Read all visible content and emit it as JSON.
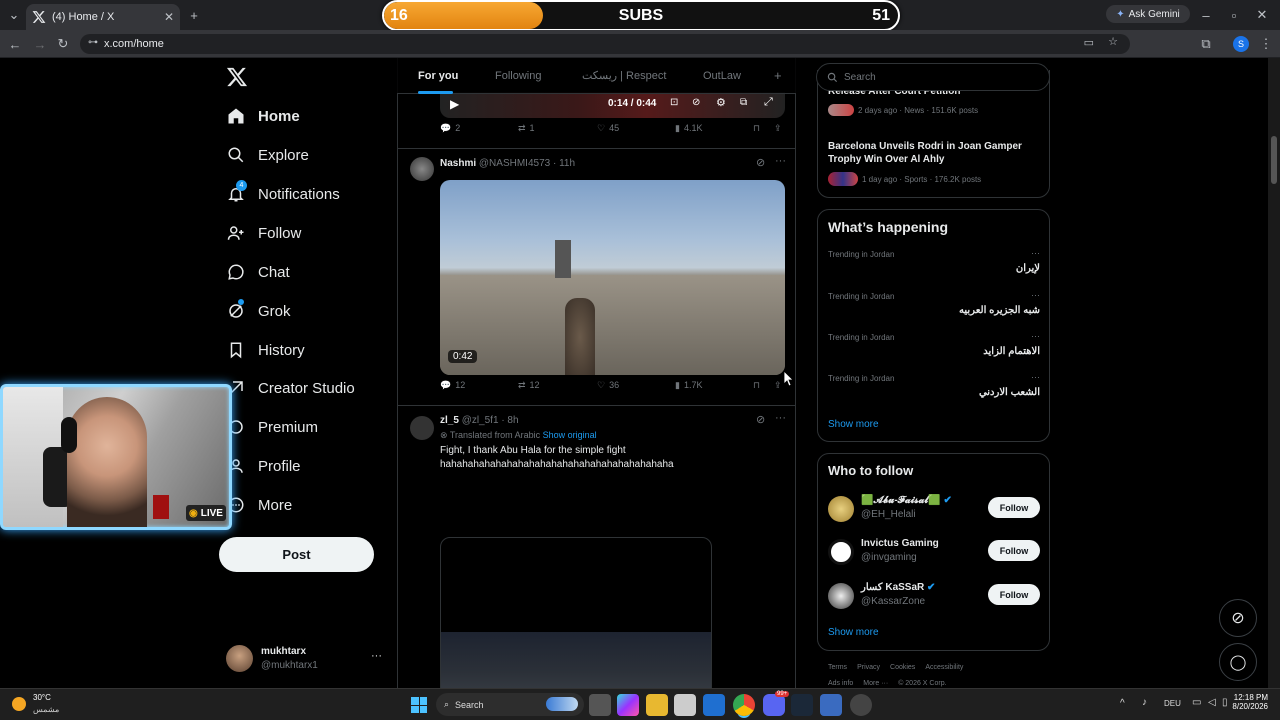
{
  "browser": {
    "tab_title": "(4) Home / X",
    "url": "x.com/home",
    "ask_gemini": "Ask Gemini"
  },
  "overlay": {
    "subs_label": "SUBS",
    "subs_left": "16",
    "subs_right": "51",
    "subs_progress": 0.31,
    "live_label": "LIVE"
  },
  "sidebar": {
    "items": [
      {
        "label": "Home",
        "icon": "home-icon"
      },
      {
        "label": "Explore",
        "icon": "search-icon"
      },
      {
        "label": "Notifications",
        "icon": "bell-icon",
        "badge": "4"
      },
      {
        "label": "Follow",
        "icon": "person-add-icon"
      },
      {
        "label": "Chat",
        "icon": "chat-icon"
      },
      {
        "label": "Grok",
        "icon": "grok-icon"
      },
      {
        "label": "History",
        "icon": "bookmark-icon"
      },
      {
        "label": "Creator Studio",
        "icon": "studio-icon"
      },
      {
        "label": "Premium",
        "icon": "premium-icon"
      },
      {
        "label": "Profile",
        "icon": "profile-icon"
      },
      {
        "label": "More",
        "icon": "more-icon"
      }
    ],
    "post_label": "Post",
    "account": {
      "name": "mukhtarx",
      "handle": "@mukhtarx1",
      "more": "···"
    }
  },
  "feed": {
    "tabs": [
      "For you",
      "Following",
      "ريسكت | Respect",
      "OutLaw"
    ],
    "add_tab": "+",
    "video_time": "0:14 / 0:44",
    "post0": {
      "replies": "2",
      "reposts": "1",
      "likes": "45",
      "views": "4.1K"
    },
    "post1": {
      "name": "Nashmi",
      "handle": "@NASHMI4573",
      "time": "· 11h",
      "duration": "0:42",
      "replies": "12",
      "reposts": "12",
      "likes": "36",
      "views": "1.7K"
    },
    "post2": {
      "name": "zl_5",
      "handle": "@zl_5f1",
      "time": "· 8h",
      "translated": "Translated from Arabic",
      "show_original": "Show original",
      "text1": "Fight, I thank Abu Hala for the simple fight",
      "text2": "hahahahahahahahahahahahahahahahahahahahaha"
    }
  },
  "right": {
    "search_placeholder": "Search",
    "news": [
      {
        "title": "Release After Court Petition",
        "meta": "2 days ago · News · 151.6K posts"
      },
      {
        "title": "Barcelona Unveils Rodri in Joan Gamper Trophy Win Over Al Ahly",
        "meta": "1 day ago · Sports · 176.2K posts"
      }
    ],
    "happening_title": "What’s happening",
    "trends": [
      {
        "meta": "Trending in Jordan",
        "name": "لإيران"
      },
      {
        "meta": "Trending in Jordan",
        "name": "شبه الجزيره العربيه"
      },
      {
        "meta": "Trending in Jordan",
        "name": "الاهتمام الزايد"
      },
      {
        "meta": "Trending in Jordan",
        "name": "الشعب الاردني"
      }
    ],
    "trend_more": "···",
    "show_more": "Show more",
    "wtf_title": "Who to follow",
    "follow": [
      {
        "name": "🟩𝓐𝓫𝓾-𝓕𝓪𝓲𝓼𝓪𝓵🟩",
        "handle": "@EH_Helali",
        "button": "Follow"
      },
      {
        "name": "Invictus Gaming",
        "handle": "@invgaming",
        "button": "Follow"
      },
      {
        "name": "كسار KaSSaR",
        "handle": "@KassarZone",
        "button": "Follow"
      }
    ],
    "footer": {
      "row1": [
        "Terms",
        "Privacy",
        "Cookies",
        "Accessibility"
      ],
      "row2": [
        "Ads info",
        "More ···",
        "© 2026 X Corp."
      ]
    }
  },
  "taskbar": {
    "weather_temp": "30°C",
    "weather_desc": "مشمس",
    "search": "Search",
    "lang": "DEU",
    "time": "12:18 PM",
    "date": "8/20/2026",
    "discord_badge": "99+"
  },
  "colors": {
    "accent": "#1d9bf0",
    "subs_fill": "#f29a22",
    "live_border": "#8fd8ff"
  }
}
